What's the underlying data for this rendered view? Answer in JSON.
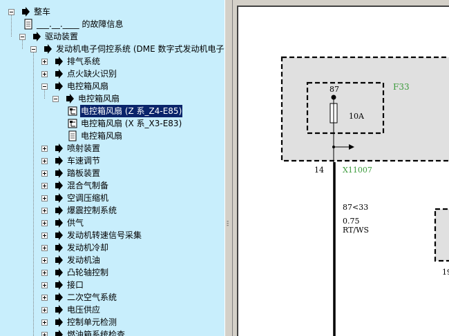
{
  "tree": {
    "items": [
      {
        "label": "整车",
        "level": 0,
        "expander": "minus",
        "icon": "arrow"
      },
      {
        "label": "___.__.____ 的故障信息",
        "level": 1,
        "expander": "none",
        "icon": "document"
      },
      {
        "label": "驱动装置",
        "level": 1,
        "expander": "minus",
        "icon": "arrow"
      },
      {
        "label": "发动机电子伺控系统 (DME 数字式发动机电子伺",
        "level": 2,
        "expander": "minus",
        "icon": "arrow"
      },
      {
        "label": "排气系统",
        "level": 3,
        "expander": "plus",
        "icon": "arrow"
      },
      {
        "label": "点火缺火识别",
        "level": 3,
        "expander": "plus",
        "icon": "arrow"
      },
      {
        "label": "电控箱风扇",
        "level": 3,
        "expander": "minus",
        "icon": "arrow"
      },
      {
        "label": "电控箱风扇",
        "level": 4,
        "expander": "minus",
        "icon": "arrow"
      },
      {
        "label": "电控箱风扇 (Z 系_Z4-E85)",
        "level": 5,
        "expander": "none",
        "icon": "diagram",
        "selected": true
      },
      {
        "label": "电控箱风扇 (X 系_X3-E83)",
        "level": 5,
        "expander": "none",
        "icon": "diagram"
      },
      {
        "label": "电控箱风扇",
        "level": 5,
        "expander": "none",
        "icon": "document"
      },
      {
        "label": "喷射装置",
        "level": 3,
        "expander": "plus",
        "icon": "arrow"
      },
      {
        "label": "车速调节",
        "level": 3,
        "expander": "plus",
        "icon": "arrow"
      },
      {
        "label": "踏板装置",
        "level": 3,
        "expander": "plus",
        "icon": "arrow"
      },
      {
        "label": "混合气制备",
        "level": 3,
        "expander": "plus",
        "icon": "arrow"
      },
      {
        "label": "空调压缩机",
        "level": 3,
        "expander": "plus",
        "icon": "arrow"
      },
      {
        "label": "爆震控制系统",
        "level": 3,
        "expander": "plus",
        "icon": "arrow"
      },
      {
        "label": "供气",
        "level": 3,
        "expander": "plus",
        "icon": "arrow"
      },
      {
        "label": "发动机转速信号采集",
        "level": 3,
        "expander": "plus",
        "icon": "arrow"
      },
      {
        "label": "发动机冷却",
        "level": 3,
        "expander": "plus",
        "icon": "arrow"
      },
      {
        "label": "发动机油",
        "level": 3,
        "expander": "plus",
        "icon": "arrow"
      },
      {
        "label": "凸轮轴控制",
        "level": 3,
        "expander": "plus",
        "icon": "arrow"
      },
      {
        "label": "接口",
        "level": 3,
        "expander": "plus",
        "icon": "arrow"
      },
      {
        "label": "二次空气系统",
        "level": 3,
        "expander": "plus",
        "icon": "arrow"
      },
      {
        "label": "电压供应",
        "level": 3,
        "expander": "plus",
        "icon": "arrow"
      },
      {
        "label": "控制单元检测",
        "level": 3,
        "expander": "plus",
        "icon": "arrow"
      },
      {
        "label": "燃油箱系统检查",
        "level": 3,
        "expander": "plus",
        "icon": "arrow"
      }
    ]
  },
  "diagram": {
    "fuse_block_label": "F33",
    "fuse_pin": "87",
    "fuse_rating": "10A",
    "pin_number": "14",
    "connector": "X11007",
    "wire_ref": "87<33",
    "wire_gauge": "0.75",
    "wire_color": "RT/WS",
    "partial_pin": "19",
    "accent_color": "#3a9a3a"
  }
}
